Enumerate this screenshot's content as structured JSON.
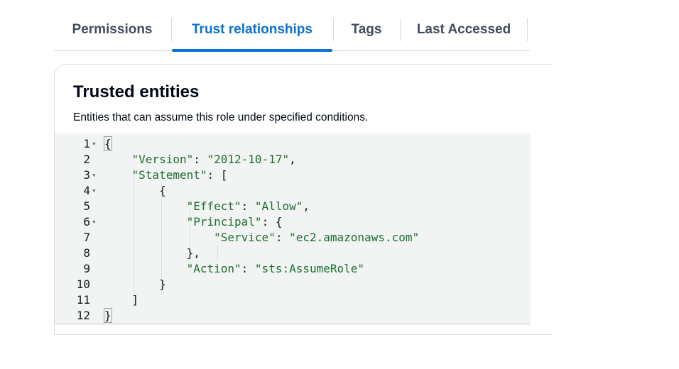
{
  "tabs": [
    {
      "label": "Permissions",
      "active": false
    },
    {
      "label": "Trust relationships",
      "active": true
    },
    {
      "label": "Tags",
      "active": false
    },
    {
      "label": "Last Accessed",
      "active": false
    }
  ],
  "panel": {
    "title": "Trusted entities",
    "description": "Entities that can assume this role under specified conditions."
  },
  "editor": {
    "lines": [
      {
        "number": "1",
        "foldable": true,
        "tokens": [
          {
            "t": "{",
            "c": "punct"
          }
        ]
      },
      {
        "number": "2",
        "foldable": false,
        "tokens": [
          {
            "t": "    "
          },
          {
            "t": "\"Version\"",
            "c": "str"
          },
          {
            "t": ": ",
            "c": "punct"
          },
          {
            "t": "\"2012-10-17\"",
            "c": "str"
          },
          {
            "t": ",",
            "c": "punct"
          }
        ]
      },
      {
        "number": "3",
        "foldable": true,
        "tokens": [
          {
            "t": "    "
          },
          {
            "t": "\"Statement\"",
            "c": "str"
          },
          {
            "t": ": [",
            "c": "punct"
          }
        ]
      },
      {
        "number": "4",
        "foldable": true,
        "tokens": [
          {
            "t": "        "
          },
          {
            "t": "{",
            "c": "punct"
          }
        ]
      },
      {
        "number": "5",
        "foldable": false,
        "tokens": [
          {
            "t": "            "
          },
          {
            "t": "\"Effect\"",
            "c": "str"
          },
          {
            "t": ": ",
            "c": "punct"
          },
          {
            "t": "\"Allow\"",
            "c": "str"
          },
          {
            "t": ",",
            "c": "punct"
          }
        ]
      },
      {
        "number": "6",
        "foldable": true,
        "tokens": [
          {
            "t": "            "
          },
          {
            "t": "\"Principal\"",
            "c": "str"
          },
          {
            "t": ": {",
            "c": "punct"
          }
        ]
      },
      {
        "number": "7",
        "foldable": false,
        "tokens": [
          {
            "t": "                "
          },
          {
            "t": "\"Service\"",
            "c": "str"
          },
          {
            "t": ": ",
            "c": "punct"
          },
          {
            "t": "\"ec2.amazonaws.com\"",
            "c": "str"
          }
        ]
      },
      {
        "number": "8",
        "foldable": false,
        "tokens": [
          {
            "t": "            "
          },
          {
            "t": "},",
            "c": "punct"
          }
        ]
      },
      {
        "number": "9",
        "foldable": false,
        "tokens": [
          {
            "t": "            "
          },
          {
            "t": "\"Action\"",
            "c": "str"
          },
          {
            "t": ": ",
            "c": "punct"
          },
          {
            "t": "\"sts:AssumeRole\"",
            "c": "str"
          }
        ]
      },
      {
        "number": "10",
        "foldable": false,
        "tokens": [
          {
            "t": "        "
          },
          {
            "t": "}",
            "c": "punct"
          }
        ]
      },
      {
        "number": "11",
        "foldable": false,
        "tokens": [
          {
            "t": "    "
          },
          {
            "t": "]",
            "c": "punct"
          }
        ]
      },
      {
        "number": "12",
        "foldable": false,
        "tokens": [
          {
            "t": "}",
            "c": "punct"
          }
        ]
      }
    ]
  },
  "colors": {
    "accent": "#0972d3",
    "string": "#1a6f2b",
    "editor_bg": "#f2f3f3"
  },
  "icons": {
    "fold": "fold-arrow-icon"
  }
}
